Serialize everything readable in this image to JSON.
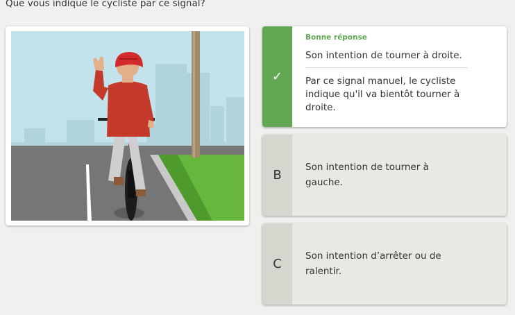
{
  "question": "Que vous indique le cycliste par ce signal?",
  "illustration": {
    "alt": "Cycliste avec le bras gauche levé",
    "colors": {
      "sky": "#bfe0ea",
      "road": "#7a7a7a",
      "grass": "#6cb842",
      "shirt": "#c43a2a",
      "helmet": "#d12b2b"
    }
  },
  "answers": [
    {
      "marker_icon": "check-icon",
      "marker_glyph": "✓",
      "status": "Bonne réponse",
      "text": "Son intention de tourner à droite.",
      "explanation": "Par ce signal manuel, le cycliste indique qu'il va bientôt tourner à droite.",
      "correct": true
    },
    {
      "marker": "B",
      "text": "Son intention de tourner à gauche."
    },
    {
      "marker": "C",
      "text": "Son intention d’arrêter ou de ralentir."
    }
  ],
  "colors": {
    "correct": "#62a854",
    "option_bg": "#e7e9e3",
    "marker_bg": "#d4d7ce"
  }
}
